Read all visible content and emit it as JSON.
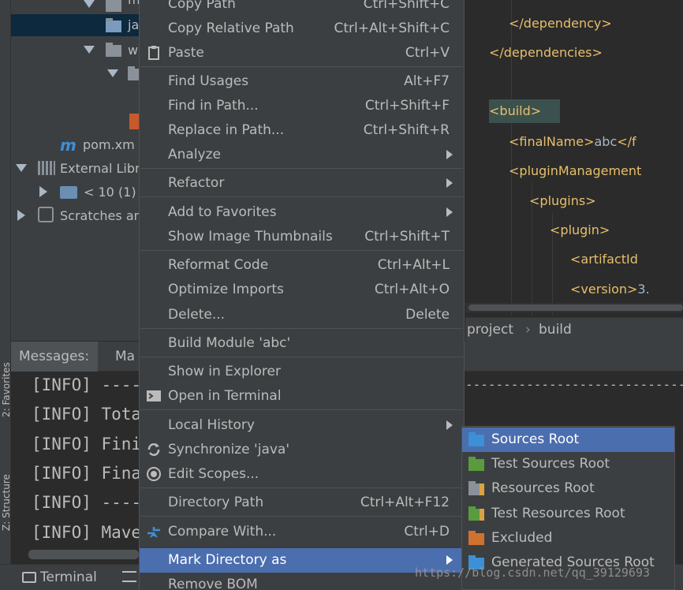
{
  "project_tree": {
    "items": [
      {
        "label": "main"
      },
      {
        "label": "ja"
      },
      {
        "label": "w"
      },
      {
        "label": "pom.xm",
        "icon": "m"
      },
      {
        "label": "External Libr"
      },
      {
        "label": "< 10 (1)"
      },
      {
        "label": "Scratches an"
      }
    ]
  },
  "editor": {
    "lines": [
      {
        "tag_open": "</dependency>",
        "text": "",
        "tag_close": ""
      },
      {
        "tag_open": "</dependencies>",
        "text": "",
        "tag_close": ""
      },
      {
        "tag_open": "<build>",
        "text": "",
        "tag_close": ""
      },
      {
        "tag_open": "<finalName>",
        "text": "abc",
        "tag_close": "</f"
      },
      {
        "tag_open": "<pluginManagement",
        "text": "",
        "tag_close": ""
      },
      {
        "tag_open": "<plugins>",
        "text": "",
        "tag_close": ""
      },
      {
        "tag_open": "<plugin>",
        "text": "",
        "tag_close": ""
      },
      {
        "tag_open": "<artifactId",
        "text": "",
        "tag_close": ""
      },
      {
        "tag_open": "<version>",
        "text": "3.",
        "tag_close": ""
      }
    ],
    "breadcrumb": [
      "project",
      "build"
    ]
  },
  "messages": {
    "tab_label": "Messages:",
    "tab2_label": "Ma",
    "lines": [
      "[INFO] ----",
      "[INFO] Tota",
      "[INFO] Fini",
      "[INFO] Fina",
      "[INFO] ----",
      "[INFO] Mave"
    ],
    "dashes": "-------------------------------------"
  },
  "bottom_bar": {
    "terminal_label": "Terminal"
  },
  "side_labels": {
    "favorites": "2: Favorites",
    "structure": "Z: Structure"
  },
  "context_menu": {
    "items": [
      {
        "label": "Copy Path",
        "shortcut": "Ctrl+Shift+C"
      },
      {
        "label": "Copy Relative Path",
        "shortcut": "Ctrl+Alt+Shift+C"
      },
      {
        "label": "Paste",
        "shortcut": "Ctrl+V",
        "icon": "paste-icon"
      },
      {
        "label": "Find Usages",
        "shortcut": "Alt+F7"
      },
      {
        "label": "Find in Path...",
        "shortcut": "Ctrl+Shift+F"
      },
      {
        "label": "Replace in Path...",
        "shortcut": "Ctrl+Shift+R"
      },
      {
        "label": "Analyze",
        "shortcut": "",
        "submenu": true
      },
      {
        "label": "Refactor",
        "shortcut": "",
        "submenu": true
      },
      {
        "label": "Add to Favorites",
        "shortcut": "",
        "submenu": true
      },
      {
        "label": "Show Image Thumbnails",
        "shortcut": "Ctrl+Shift+T"
      },
      {
        "label": "Reformat Code",
        "shortcut": "Ctrl+Alt+L"
      },
      {
        "label": "Optimize Imports",
        "shortcut": "Ctrl+Alt+O"
      },
      {
        "label": "Delete...",
        "shortcut": "Delete"
      },
      {
        "label": "Build Module 'abc'",
        "shortcut": ""
      },
      {
        "label": "Show in Explorer",
        "shortcut": ""
      },
      {
        "label": "Open in Terminal",
        "shortcut": "",
        "icon": "terminal-icon"
      },
      {
        "label": "Local History",
        "shortcut": "",
        "submenu": true
      },
      {
        "label": "Synchronize 'java'",
        "shortcut": "",
        "icon": "sync-icon"
      },
      {
        "label": "Edit Scopes...",
        "shortcut": "",
        "icon": "scope-icon"
      },
      {
        "label": "Directory Path",
        "shortcut": "Ctrl+Alt+F12"
      },
      {
        "label": "Compare With...",
        "shortcut": "Ctrl+D",
        "icon": "compare-icon"
      },
      {
        "label": "Mark Directory as",
        "shortcut": "",
        "submenu": true,
        "selected": true
      },
      {
        "label": "Remove BOM",
        "shortcut": ""
      }
    ]
  },
  "submenu": {
    "items": [
      {
        "label": "Sources Root",
        "icon": "folder-blue-icon",
        "color": "#3d8fd6",
        "selected": true
      },
      {
        "label": "Test Sources Root",
        "icon": "folder-green-icon",
        "color": "#5a9b3d"
      },
      {
        "label": "Resources Root",
        "icon": "folder-resources-icon",
        "color": "#8a9199"
      },
      {
        "label": "Test Resources Root",
        "icon": "folder-test-resources-icon",
        "color": "#8a9199"
      },
      {
        "label": "Excluded",
        "icon": "folder-orange-icon",
        "color": "#d0722f"
      },
      {
        "label": "Generated Sources Root",
        "icon": "folder-generated-icon",
        "color": "#3d8fd6"
      }
    ]
  },
  "watermark": "https://blog.csdn.net/qq_39129693",
  "colors": {
    "menu_bg": "#3c3f41",
    "selection": "#4b6eaf",
    "editor_bg": "#2b2b2b",
    "tag": "#e8bf6a"
  }
}
